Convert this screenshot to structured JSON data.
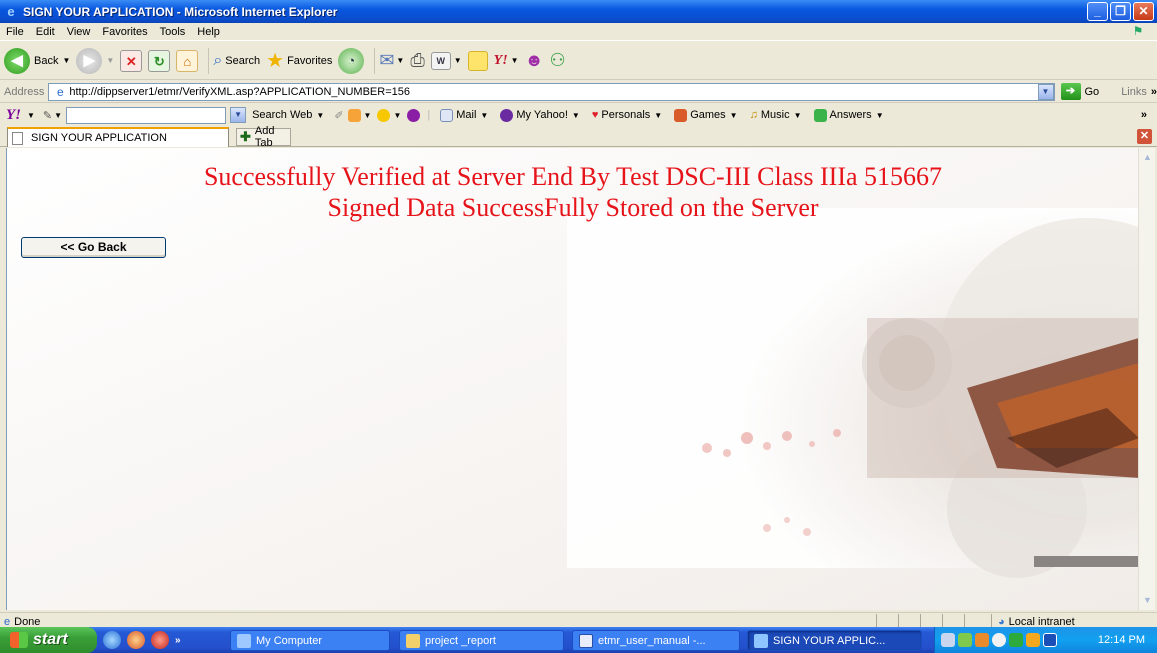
{
  "window": {
    "title": "SIGN YOUR APPLICATION - Microsoft Internet Explorer"
  },
  "menu": [
    "File",
    "Edit",
    "View",
    "Favorites",
    "Tools",
    "Help"
  ],
  "toolbar": {
    "back_label": "Back",
    "search_label": "Search",
    "favorites_label": "Favorites"
  },
  "address": {
    "label": "Address",
    "url": "http://dippserver1/etmr/VerifyXML.asp?APPLICATION_NUMBER=156",
    "go_label": "Go",
    "links_label": "Links"
  },
  "yahoo_bar": {
    "logo": "Y!",
    "search_web": "Search Web",
    "items": [
      "Mail",
      "My Yahoo!",
      "Personals",
      "Games",
      "Music",
      "Answers"
    ]
  },
  "tabs": {
    "active_tab": "SIGN YOUR APPLICATION",
    "add_tab": "Add Tab"
  },
  "content": {
    "message_line1": "Successfully Verified at Server End By Test DSC-III Class IIIa 515667",
    "message_line2": "Signed Data SuccessFully Stored on the Server",
    "go_back_button": "<< Go Back",
    "message_color": "#e6141a"
  },
  "status": {
    "left": "Done",
    "zone": "Local intranet"
  },
  "taskbar": {
    "start": "start",
    "buttons": [
      {
        "label": "My Computer"
      },
      {
        "label": "project _report"
      },
      {
        "label": "etmr_user_manual -..."
      },
      {
        "label": "SIGN YOUR APPLIC..."
      }
    ],
    "clock": "12:14 PM"
  }
}
